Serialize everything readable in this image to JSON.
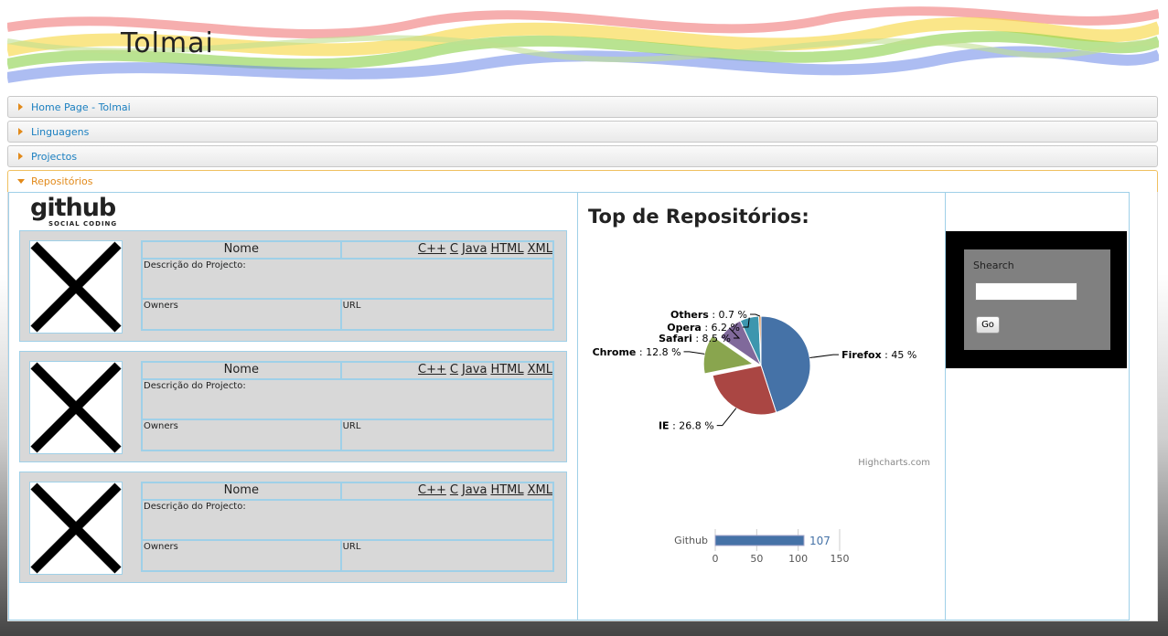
{
  "header": {
    "logo_text": "Tolmai"
  },
  "accordion": [
    {
      "label": "Home Page - Tolmai",
      "open": false
    },
    {
      "label": "Linguagens",
      "open": false
    },
    {
      "label": "Projectos",
      "open": false
    },
    {
      "label": "Repositórios",
      "open": true
    }
  ],
  "github": {
    "logo": "github",
    "tagline": "SOCIAL CODING"
  },
  "repos": [
    {
      "name_label": "Nome",
      "langs": [
        "C++",
        "C",
        "Java",
        "HTML",
        "XML"
      ],
      "desc_label": "Descrição do Projecto:",
      "owners_label": "Owners",
      "url_label": "URL"
    },
    {
      "name_label": "Nome",
      "langs": [
        "C++",
        "C",
        "Java",
        "HTML",
        "XML"
      ],
      "desc_label": "Descrição do Projecto:",
      "owners_label": "Owners",
      "url_label": "URL"
    },
    {
      "name_label": "Nome",
      "langs": [
        "C++",
        "C",
        "Java",
        "HTML",
        "XML"
      ],
      "desc_label": "Descrição do Projecto:",
      "owners_label": "Owners",
      "url_label": "URL"
    }
  ],
  "chart_section": {
    "title": "Top de Repositórios:",
    "credit": "Highcharts.com"
  },
  "chart_data": [
    {
      "type": "pie",
      "categories": [
        "Firefox",
        "IE",
        "Chrome",
        "Safari",
        "Opera",
        "Others"
      ],
      "values": [
        45,
        26.8,
        12.8,
        8.5,
        6.2,
        0.7
      ],
      "labels": [
        "45 %",
        "26.8 %",
        "12.8 %",
        "8.5 %",
        "6.2 %",
        "0.7 %"
      ],
      "colors": [
        "#4572a7",
        "#aa4643",
        "#89a54e",
        "#80699b",
        "#3d96ae",
        "#db843d"
      ],
      "sliced": "Chrome"
    },
    {
      "type": "bar",
      "categories": [
        "Github"
      ],
      "values": [
        107
      ],
      "xlim": [
        0,
        150
      ],
      "ticks": [
        "0",
        "50",
        "100",
        "150"
      ],
      "color": "#4572a7"
    }
  ],
  "search": {
    "label": "Shearch",
    "button": "Go",
    "value": ""
  }
}
